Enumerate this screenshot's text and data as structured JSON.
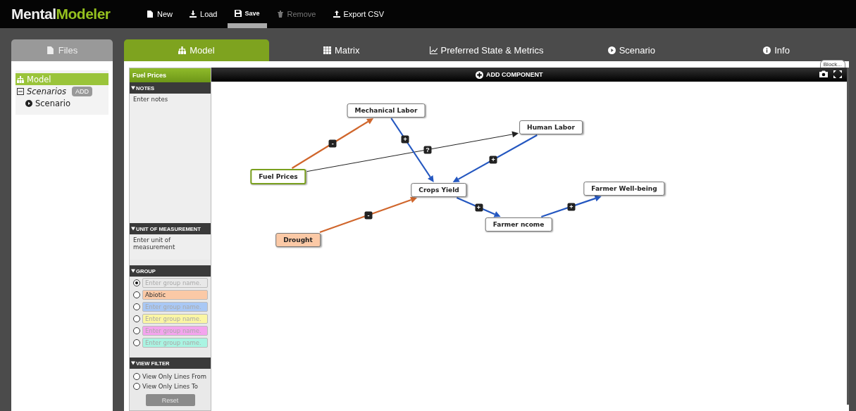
{
  "logo": {
    "first": "Mental",
    "second": "Modeler"
  },
  "menu": [
    {
      "label": "New",
      "active": false,
      "disabled": false
    },
    {
      "label": "Load",
      "active": false,
      "disabled": false
    },
    {
      "label": "Save",
      "active": true,
      "disabled": false
    },
    {
      "label": "Remove",
      "active": false,
      "disabled": true
    },
    {
      "label": "Export CSV",
      "active": false,
      "disabled": false
    }
  ],
  "files_tab": {
    "label": "Files",
    "selected": false
  },
  "tabs": [
    {
      "label": "Model",
      "selected": true
    },
    {
      "label": "Matrix",
      "selected": false
    },
    {
      "label": "Preferred State & Metrics",
      "selected": false
    },
    {
      "label": "Scenario",
      "selected": false
    },
    {
      "label": "Info",
      "selected": false
    }
  ],
  "sidebar": {
    "items": [
      {
        "label": "Model",
        "selected": true
      },
      {
        "label": "Scenarios",
        "selected": false,
        "expanded": true,
        "action": "ADD",
        "children": [
          {
            "label": "Scenario",
            "selected": false
          }
        ]
      }
    ]
  },
  "component_panel": {
    "title": "Fuel Prices",
    "notes": {
      "heading": "NOTES",
      "placeholder": "Enter notes"
    },
    "unit": {
      "heading": "UNIT OF MEASUREMENT",
      "placeholder": "Enter unit of measurement"
    },
    "group": {
      "heading": "GROUP",
      "items": [
        {
          "placeholder": "Enter group name.",
          "selected": true,
          "color": "#e8e8e8"
        },
        {
          "value": "Abiotic",
          "selected": false,
          "color": "#fbc9a6"
        },
        {
          "placeholder": "Enter group name.",
          "selected": false,
          "color": "#a9c8f5"
        },
        {
          "placeholder": "Enter group name.",
          "selected": false,
          "color": "#fbf6a4"
        },
        {
          "placeholder": "Enter group name.",
          "selected": false,
          "color": "#f4a4ee"
        },
        {
          "placeholder": "Enter group name.",
          "selected": false,
          "color": "#a9f4e2"
        }
      ]
    },
    "view_filter": {
      "heading": "VIEW FILTER",
      "options": [
        {
          "label": "View Only Lines From",
          "selected": false
        },
        {
          "label": "View Only Lines To",
          "selected": false
        }
      ],
      "reset": {
        "label": "Reset",
        "disabled": true
      }
    }
  },
  "canvas": {
    "toolbar": {
      "add_label": "ADD COMPONENT",
      "block_label": "Block..."
    },
    "nodes": [
      {
        "label": "Mechanical Labor",
        "selected": false,
        "color": "#ffffff"
      },
      {
        "label": "Human Labor",
        "selected": false,
        "color": "#ffffff"
      },
      {
        "label": "Fuel Prices",
        "selected": true,
        "color": "#ffffff"
      },
      {
        "label": "Crops Yield",
        "selected": false,
        "color": "#ffffff"
      },
      {
        "label": "Farmer Well-being",
        "selected": false,
        "color": "#ffffff"
      },
      {
        "label": "Farmer ncome",
        "selected": false,
        "color": "#ffffff"
      },
      {
        "label": "Drought",
        "selected": false,
        "color": "#fbc9a6"
      }
    ],
    "edges": [
      {
        "kind": "negative",
        "sign": "-"
      },
      {
        "kind": "unknown",
        "sign": "?"
      },
      {
        "kind": "positive",
        "sign": "+"
      },
      {
        "kind": "positive",
        "sign": "+"
      },
      {
        "kind": "negative",
        "sign": "-"
      },
      {
        "kind": "positive",
        "sign": "+"
      },
      {
        "kind": "positive",
        "sign": "+"
      }
    ]
  }
}
